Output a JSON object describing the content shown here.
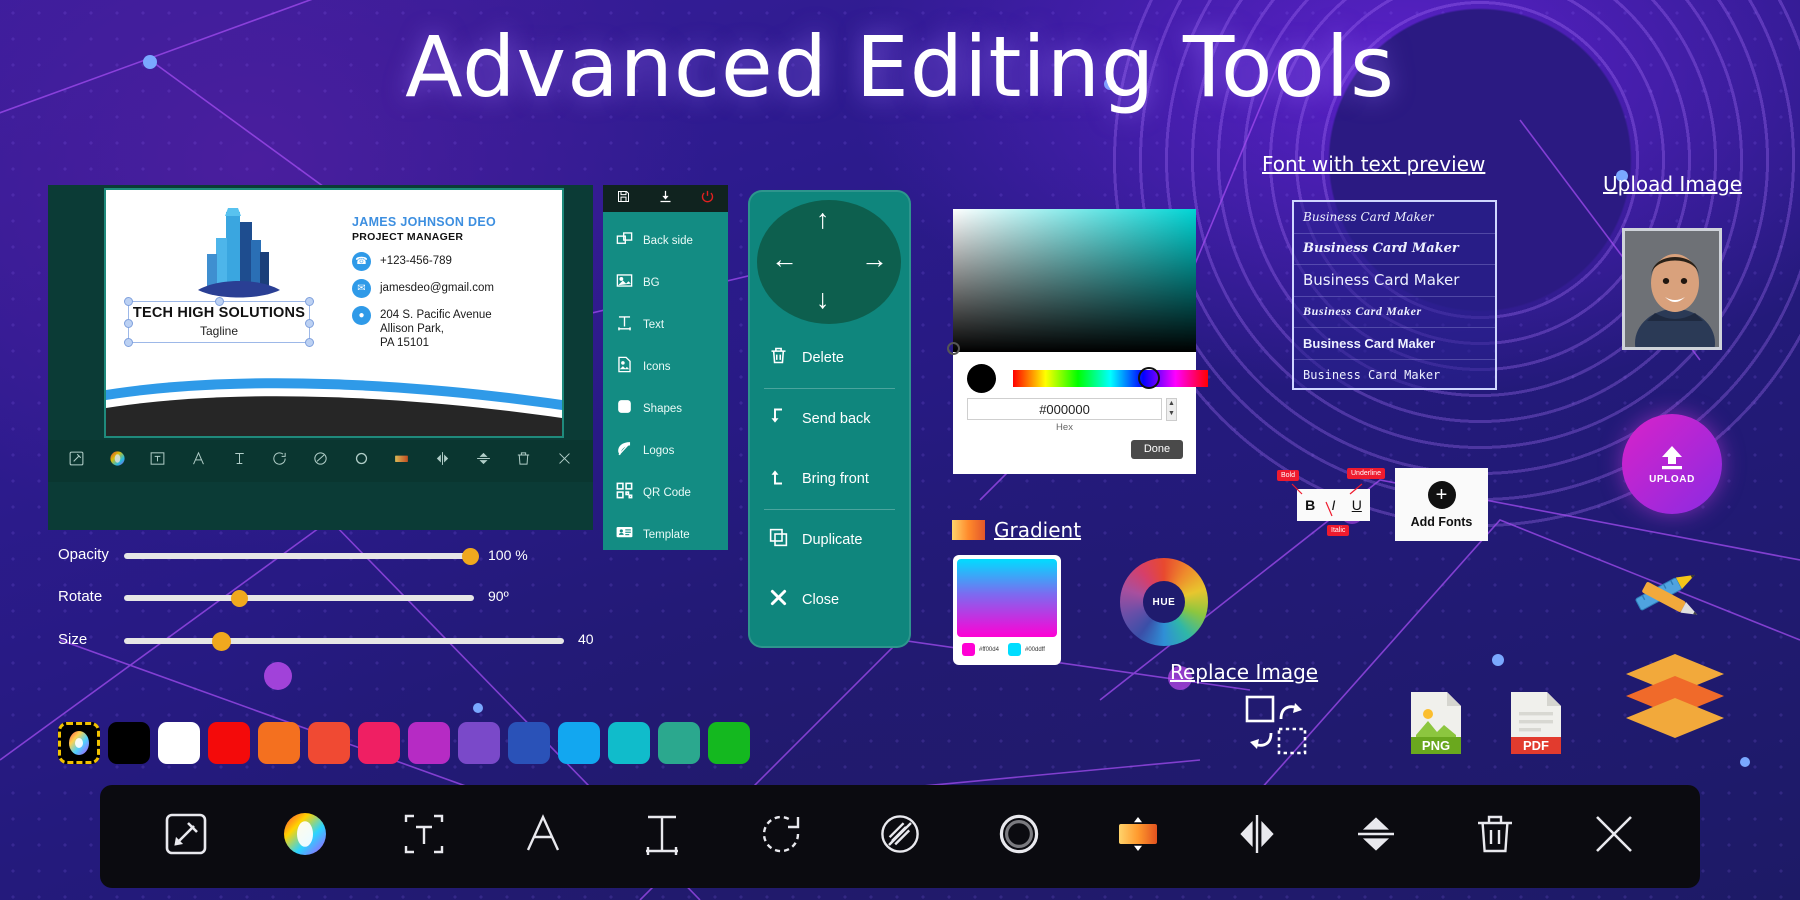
{
  "page": {
    "title": "Advanced Editing Tools"
  },
  "business_card": {
    "company_name": "TECH HIGH SOLUTIONS",
    "tagline": "Tagline",
    "person_name": "JAMES JOHNSON DEO",
    "person_role": "PROJECT MANAGER",
    "phone": "+123-456-789",
    "email": "jamesdeo@gmail.com",
    "address_line1": "204 S. Pacific Avenue",
    "address_line2": "Allison Park,",
    "address_line3": "PA 15101"
  },
  "editor_toolbar": {
    "icons": [
      "edit-icon",
      "color-wheel-icon",
      "text-box-icon",
      "font-icon",
      "text-spacing-icon",
      "rotate-icon",
      "eraser-icon",
      "circle-icon",
      "gradient-icon",
      "flip-horizontal-icon",
      "flip-vertical-icon",
      "delete-icon",
      "close-icon"
    ]
  },
  "top_icons": [
    {
      "name": "save-icon",
      "label": "Save"
    },
    {
      "name": "download-icon",
      "label": "Download"
    },
    {
      "name": "power-icon",
      "label": "Exit"
    }
  ],
  "left_menu": {
    "items": [
      {
        "label": "Back side",
        "icon": "back-side-icon"
      },
      {
        "label": "BG",
        "icon": "image-icon"
      },
      {
        "label": "Text",
        "icon": "text-icon"
      },
      {
        "label": "Icons",
        "icon": "icons-icon"
      },
      {
        "label": "Shapes",
        "icon": "shapes-icon"
      },
      {
        "label": "Logos",
        "icon": "leaf-logo-icon"
      },
      {
        "label": "QR Code",
        "icon": "qr-code-icon"
      },
      {
        "label": "Template",
        "icon": "template-icon"
      }
    ]
  },
  "object_panel": {
    "dpad": {
      "up": "↑",
      "down": "↓",
      "left": "←",
      "right": "→"
    },
    "actions": [
      {
        "label": "Delete",
        "icon": "trash-icon"
      },
      {
        "label": "Send back",
        "icon": "send-back-icon"
      },
      {
        "label": "Bring front",
        "icon": "bring-front-icon"
      },
      {
        "label": "Duplicate",
        "icon": "duplicate-icon"
      },
      {
        "label": "Close",
        "icon": "close-x-icon"
      }
    ]
  },
  "color_picker": {
    "hex_value": "#000000",
    "hex_label": "Hex",
    "done_label": "Done",
    "current_color": "#000000"
  },
  "gradient": {
    "label": "Gradient",
    "stop_1": "#ff00d4",
    "stop_2": "#00ddff"
  },
  "hue_wheel": {
    "label": "HUE"
  },
  "font_preview": {
    "label": "Font with text preview",
    "rows": [
      "Business Card Maker",
      "Business Card Maker",
      "Business Card Maker",
      "Business Card Maker",
      "Business Card Maker",
      "Business Card Maker"
    ]
  },
  "text_style": {
    "bold": {
      "glyph": "B",
      "tag": "Bold"
    },
    "italic": {
      "glyph": "I",
      "tag": "Italic"
    },
    "underline": {
      "glyph": "U",
      "tag": "Underline"
    },
    "add_fonts_label": "Add Fonts"
  },
  "replace_image": {
    "label": "Replace Image"
  },
  "upload": {
    "label": "Upload Image",
    "button_label": "UPLOAD"
  },
  "export": [
    {
      "label": "PNG"
    },
    {
      "label": "PDF"
    }
  ],
  "sliders": [
    {
      "label": "Opacity",
      "value": "100 %",
      "percent": 100
    },
    {
      "label": "Rotate",
      "value": "90º",
      "percent": 25
    },
    {
      "label": "Size",
      "value": "40",
      "percent": 18
    }
  ],
  "swatches": [
    {
      "name": "custom-color-picker",
      "color": "rainbow"
    },
    {
      "name": "swatch-black",
      "color": "#000000"
    },
    {
      "name": "swatch-white",
      "color": "#ffffff"
    },
    {
      "name": "swatch-red",
      "color": "#f40a0a"
    },
    {
      "name": "swatch-orange",
      "color": "#f4701f"
    },
    {
      "name": "swatch-tomato",
      "color": "#f04a33"
    },
    {
      "name": "swatch-pink",
      "color": "#ef1f63"
    },
    {
      "name": "swatch-magenta",
      "color": "#b62bc4"
    },
    {
      "name": "swatch-purple",
      "color": "#7a49c9"
    },
    {
      "name": "swatch-indigo",
      "color": "#2a52b8"
    },
    {
      "name": "swatch-blue",
      "color": "#12a7f0"
    },
    {
      "name": "swatch-cyan",
      "color": "#10bccb"
    },
    {
      "name": "swatch-teal",
      "color": "#2ba88e"
    },
    {
      "name": "swatch-green",
      "color": "#14b81f"
    }
  ],
  "bottom_toolbar": {
    "icons": [
      "edit-icon",
      "color-wheel-icon",
      "text-box-icon",
      "font-icon",
      "text-spacing-icon",
      "rotate-icon",
      "eraser-icon",
      "circle-icon",
      "gradient-icon",
      "flip-horizontal-icon",
      "flip-vertical-icon",
      "delete-icon",
      "close-icon"
    ]
  }
}
